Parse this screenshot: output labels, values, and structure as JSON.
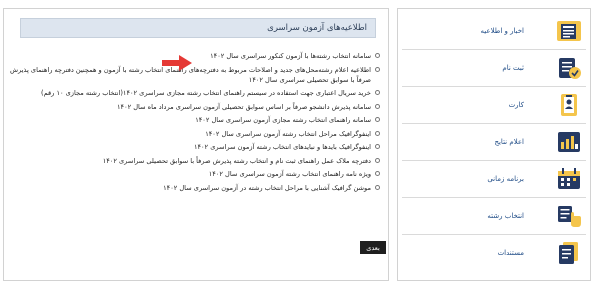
{
  "panel": {
    "title": "اطلاعیه‌های آزمون سراسری",
    "items": [
      "سامانه انتخاب رشته‌ها با آزمون کنکور سراسری سال ۱۴۰۲",
      "اطلاعیه اعلام رشته‌محل‌های جدید و اصلاحات مربوط به دفترچه‌های راهنمای انتخاب رشته با آزمون و همچنین دفترچه راهنمای پذیرش صرفاً با سوابق تحصیلی سراسری سال ۱۴۰۲",
      "خرید سریال اعتباری جهت استفاده در سیستم راهنمای انتخاب رشته مجازی سراسری ۱۴۰۲(انتخاب رشته مجازی ۱۰ رقم)",
      "سامانه پذیرش دانشجو صرفاً بر اساس سوابق تحصیلی آزمون سراسری مرداد ماه سال ۱۴۰۲",
      "سامانه راهنمای انتخاب رشته مجازی آزمون سراسری سال ۱۴۰۲",
      "اینفوگرافیک مراحل انتخاب رشته آزمون سراسری سال ۱۴۰۲",
      "اینفوگرافیک بایدها و نبایدهای انتخاب رشته آزمون سراسری ۱۴۰۲",
      "دفترچه ملاک عمل راهنمای ثبت نام و انتخاب رشته پذیرش صرفاً با سوابق تحصیلی سراسری ۱۴۰۲",
      "ویژه نامه راهنمای انتخاب رشته آزمون سراسری سال ۱۴۰۲",
      "موشن گرافیک آشنایی با مراحل انتخاب رشته در آزمون سراسری سال ۱۴۰۲"
    ],
    "next_label": "بعدی"
  },
  "menu": {
    "items": [
      {
        "label": "اخبار و اطلاعیه",
        "icon": "newspaper-icon"
      },
      {
        "label": "ثبت نام",
        "icon": "registration-form-icon"
      },
      {
        "label": "کارت",
        "icon": "id-card-icon"
      },
      {
        "label": "اعلام نتایج",
        "icon": "results-chart-icon"
      },
      {
        "label": "برنامه زمانی",
        "icon": "calendar-icon"
      },
      {
        "label": "انتخاب رشته",
        "icon": "selection-hand-icon"
      },
      {
        "label": "مستندات",
        "icon": "documents-icon"
      }
    ]
  },
  "colors": {
    "header_bg": "#dde5ef",
    "menu_label": "#1e4b86",
    "icon_dark": "#263a63",
    "icon_gold": "#e8b43a",
    "arrow_red": "#e53935"
  }
}
